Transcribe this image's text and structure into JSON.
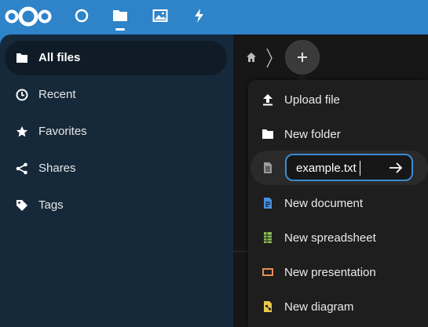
{
  "colors": {
    "header": "#2f83c8",
    "sidebar": "#16293a",
    "sidebar_active": "#0f1c28",
    "menu_bg": "#1e1e1e",
    "accent": "#3a8cd4",
    "doc_blue": "#4a90e2",
    "sheet_green": "#8bbd55",
    "slides_orange": "#e88c58",
    "diagram_yellow": "#e6c84a"
  },
  "header": {
    "logo_icon": "nextcloud-logo",
    "apps": [
      {
        "icon": "dashboard-circle-icon"
      },
      {
        "icon": "folder-icon",
        "active": true
      },
      {
        "icon": "photos-icon"
      },
      {
        "icon": "activity-lightning-icon"
      }
    ]
  },
  "sidebar": {
    "items": [
      {
        "label": "All files",
        "icon": "folder-icon",
        "active": true
      },
      {
        "label": "Recent",
        "icon": "clock-icon"
      },
      {
        "label": "Favorites",
        "icon": "star-icon"
      },
      {
        "label": "Shares",
        "icon": "share-icon"
      },
      {
        "label": "Tags",
        "icon": "tag-icon"
      }
    ]
  },
  "breadcrumb": {
    "home_icon": "home-icon",
    "add_icon": "plus-icon"
  },
  "new_menu": {
    "upload_label": "Upload file",
    "new_folder_label": "New folder",
    "rename_value": "example.txt",
    "rename_icon": "text-file-icon",
    "submit_icon": "arrow-right-icon",
    "new_document_label": "New document",
    "new_spreadsheet_label": "New spreadsheet",
    "new_presentation_label": "New presentation",
    "new_diagram_label": "New diagram"
  }
}
